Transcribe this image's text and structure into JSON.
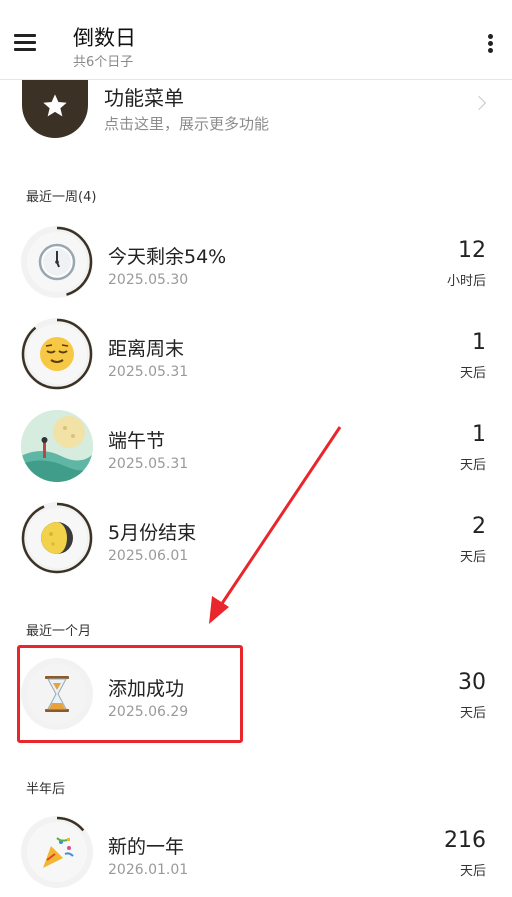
{
  "appbar": {
    "title": "倒数日",
    "subtitle": "共6个日子"
  },
  "feature": {
    "title": "功能菜单",
    "subtitle": "点击这里，展示更多功能"
  },
  "sections": {
    "week": "最近一周(4)",
    "month": "最近一个月",
    "half_year": "半年后"
  },
  "items": [
    {
      "title": "今天剩余54%",
      "date": "2025.05.30",
      "count": "12",
      "unit": "小时后",
      "icon": "clock-emoji"
    },
    {
      "title": "距离周末",
      "date": "2025.05.31",
      "count": "1",
      "unit": "天后",
      "icon": "relieved-face-emoji"
    },
    {
      "title": "端午节",
      "date": "2025.05.31",
      "count": "1",
      "unit": "天后",
      "icon": "dragon-boat-festival-illustration"
    },
    {
      "title": "5月份结束",
      "date": "2025.06.01",
      "count": "2",
      "unit": "天后",
      "icon": "moon-emoji"
    },
    {
      "title": "添加成功",
      "date": "2025.06.29",
      "count": "30",
      "unit": "天后",
      "icon": "hourglass-emoji"
    },
    {
      "title": "新的一年",
      "date": "2026.01.01",
      "count": "216",
      "unit": "天后",
      "icon": "party-popper-emoji"
    }
  ],
  "colors": {
    "ring": "#3b3225",
    "highlight": "#e8262b"
  }
}
